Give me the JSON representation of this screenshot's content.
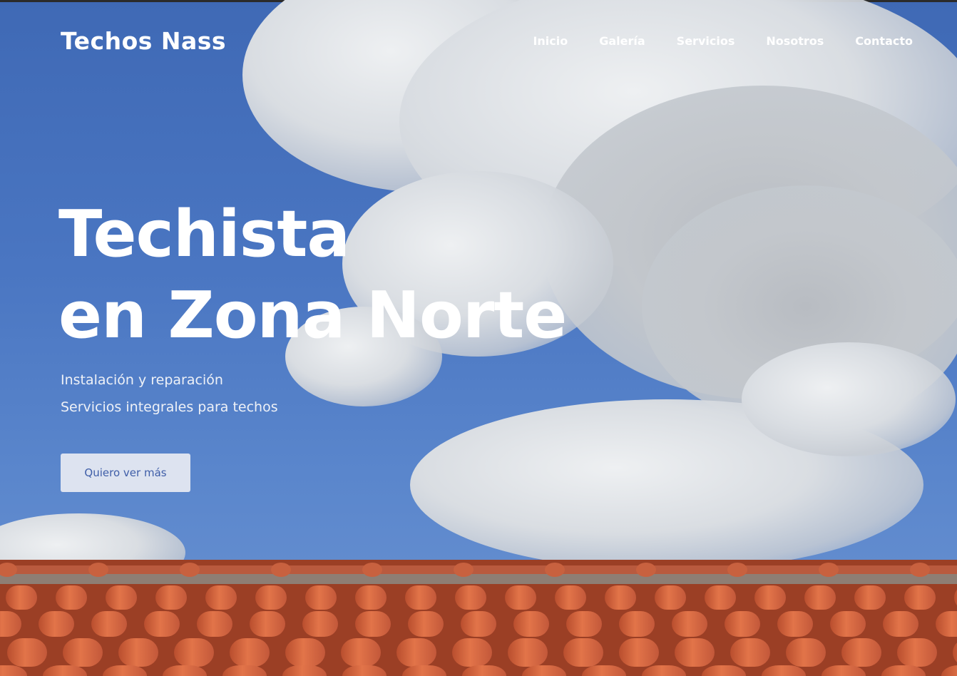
{
  "brand": {
    "name": "Techos Nass"
  },
  "nav": {
    "items": [
      {
        "label": "Inicio"
      },
      {
        "label": "Galería"
      },
      {
        "label": "Servicios"
      },
      {
        "label": "Nosotros"
      },
      {
        "label": "Contacto"
      }
    ]
  },
  "hero": {
    "headline_line1": "Techista",
    "headline_line2": "en Zona Norte",
    "subtitle_line1": "Instalación y reparación",
    "subtitle_line2": "Servicios integrales para techos",
    "cta_label": "Quiero ver más"
  },
  "colors": {
    "sky": "#4a76c2",
    "roof_tile": "#d8663f",
    "button_bg": "#dde3f0",
    "button_text": "#3f5ea8"
  }
}
